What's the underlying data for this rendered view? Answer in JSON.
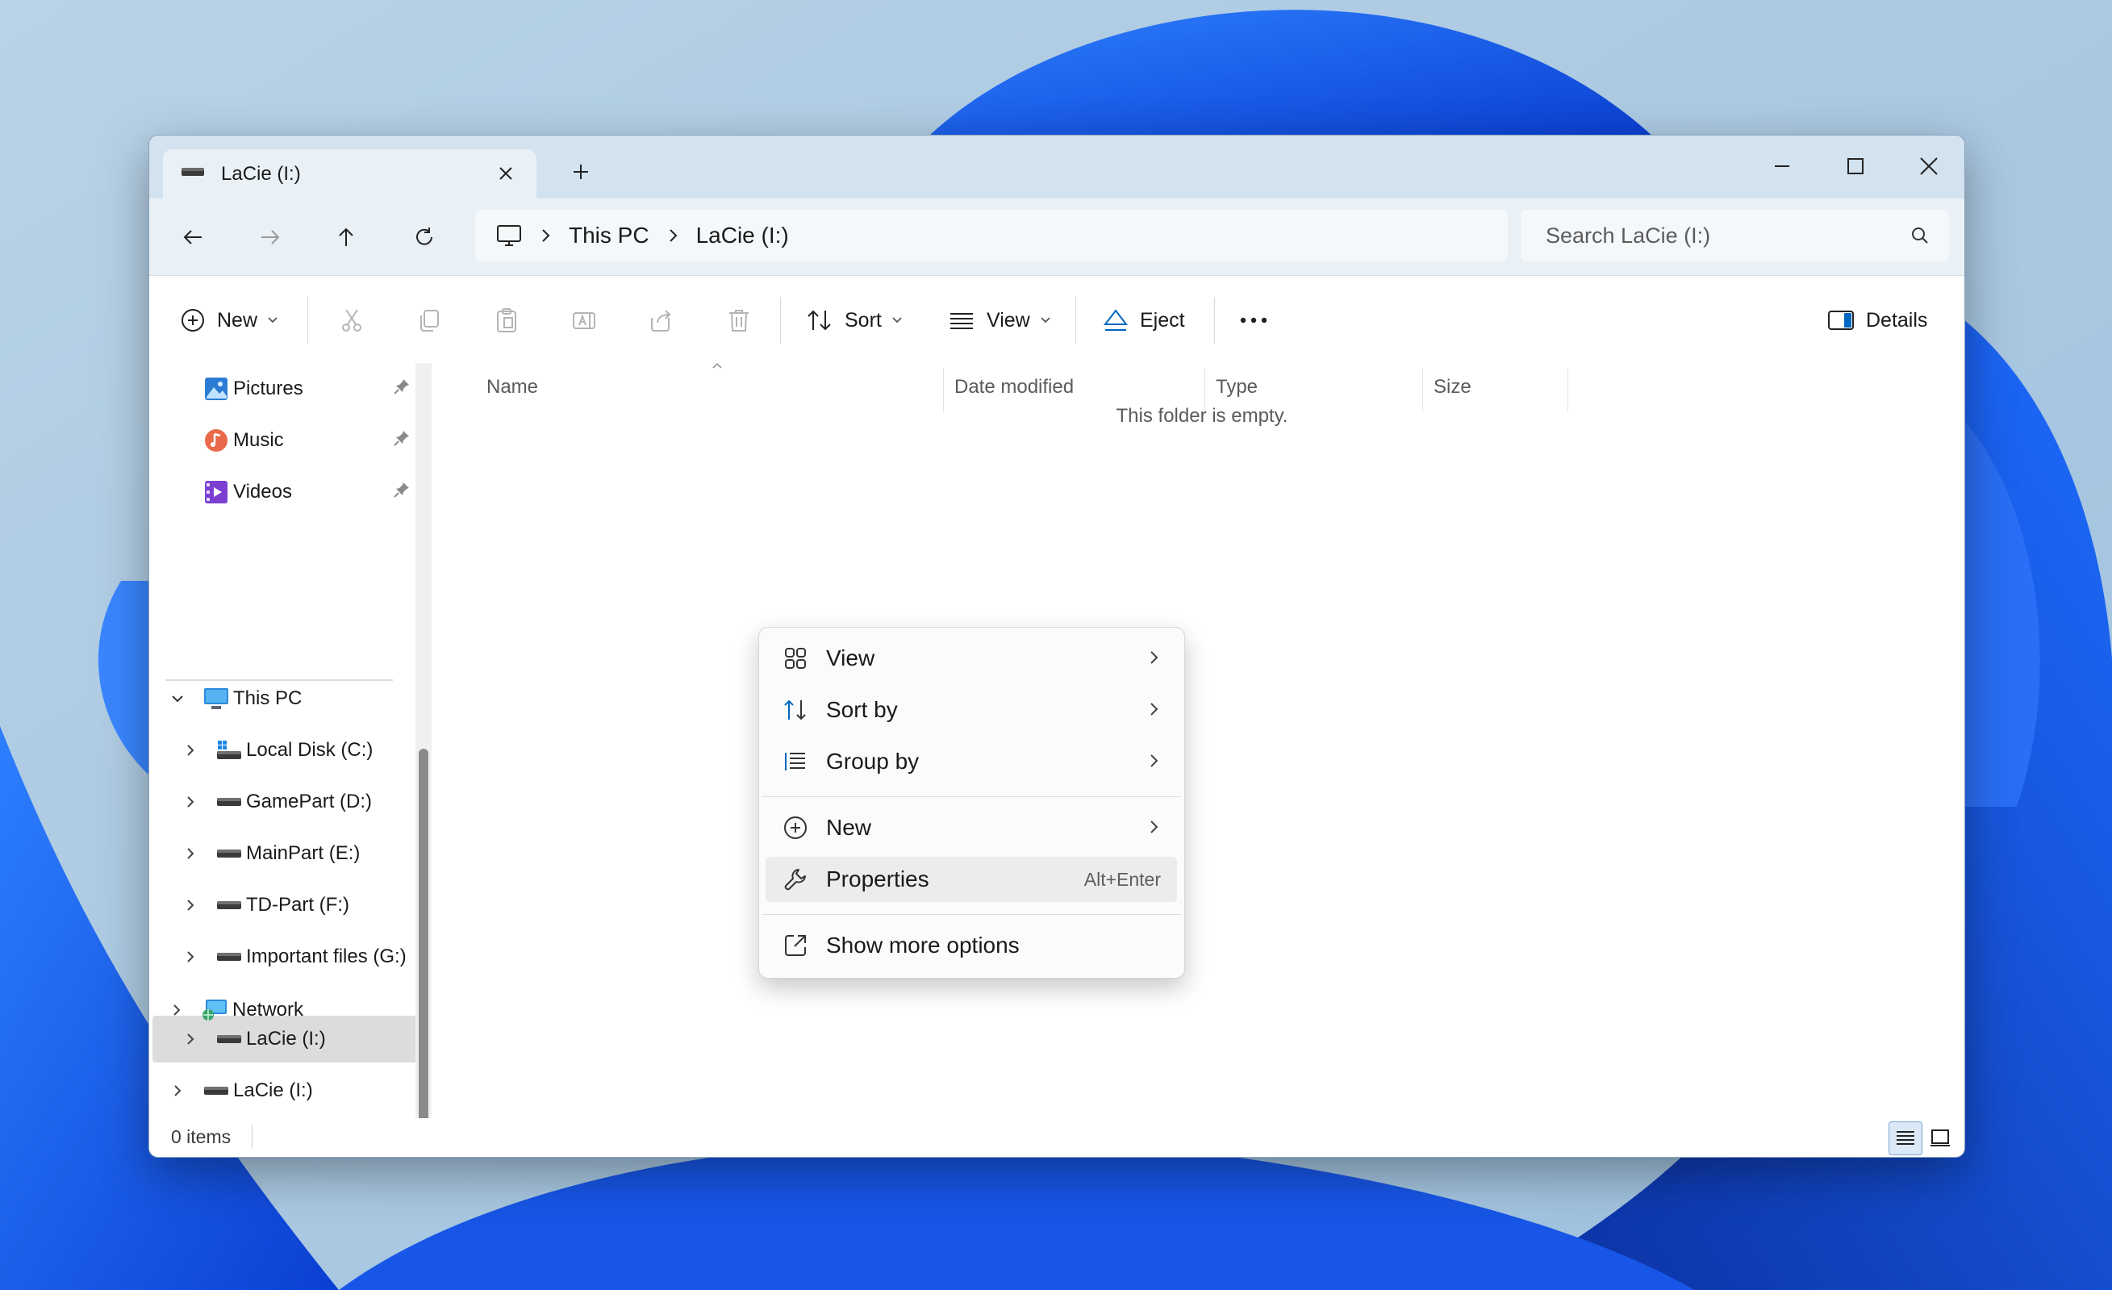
{
  "window": {
    "tab_title": "LaCie (I:)"
  },
  "address": {
    "segments": [
      "This PC",
      "LaCie (I:)"
    ],
    "search_placeholder": "Search LaCie (I:)"
  },
  "commandbar": {
    "new_label": "New",
    "sort_label": "Sort",
    "view_label": "View",
    "eject_label": "Eject",
    "details_label": "Details"
  },
  "sidebar": {
    "quick_access": [
      {
        "label": "Pictures",
        "icon": "pictures-icon"
      },
      {
        "label": "Music",
        "icon": "music-icon"
      },
      {
        "label": "Videos",
        "icon": "videos-icon"
      }
    ],
    "this_pc": "This PC",
    "drives": [
      {
        "label": "Local Disk (C:)"
      },
      {
        "label": "GamePart (D:)"
      },
      {
        "label": "MainPart (E:)"
      },
      {
        "label": "TD-Part (F:)"
      },
      {
        "label": "Important files (G:)"
      },
      {
        "label": "LaCie (I:)"
      }
    ],
    "external_drive": "LaCie (I:)",
    "network": "Network"
  },
  "content": {
    "columns": [
      "Name",
      "Date modified",
      "Type",
      "Size"
    ],
    "empty_message": "This folder is empty."
  },
  "status": {
    "item_count": "0 items"
  },
  "context_menu": {
    "items": [
      {
        "label": "View",
        "icon": "grid-icon",
        "has_submenu": true
      },
      {
        "label": "Sort by",
        "icon": "sort-icon",
        "has_submenu": true
      },
      {
        "label": "Group by",
        "icon": "group-icon",
        "has_submenu": true
      },
      {
        "label": "New",
        "icon": "plus-circle-icon",
        "has_submenu": true
      },
      {
        "label": "Properties",
        "icon": "wrench-icon",
        "shortcut": "Alt+Enter"
      },
      {
        "label": "Show more options",
        "icon": "expand-icon"
      }
    ]
  },
  "colors": {
    "accent": "#0067c0",
    "selection": "#dcdcdc",
    "window_frame": "#d3e2ef"
  }
}
